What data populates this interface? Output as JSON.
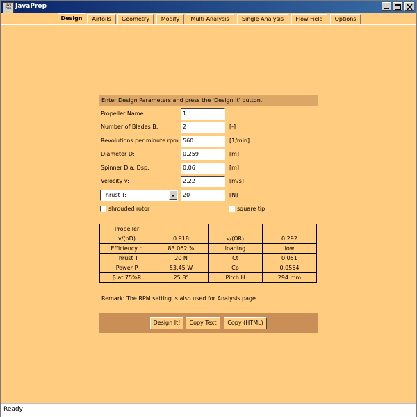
{
  "window": {
    "title": "JavaProp",
    "icon_text": "Java Prop"
  },
  "tabs": [
    {
      "label": "Design",
      "active": true
    },
    {
      "label": "Airfoils"
    },
    {
      "label": "Geometry"
    },
    {
      "label": "Modify"
    },
    {
      "label": "Multi Analysis"
    },
    {
      "label": "Single Analysis"
    },
    {
      "label": "Flow Field"
    },
    {
      "label": "Options"
    }
  ],
  "design": {
    "header": "Enter Design Parameters and press the 'Design It' button.",
    "fields": [
      {
        "label": "Propeller Name:",
        "value": "1",
        "unit": ""
      },
      {
        "label": "Number of Blades  B:",
        "value": "2",
        "unit": "[-]"
      },
      {
        "label": "Revolutions per minute  rpm:",
        "value": "560",
        "unit": "[1/min]"
      },
      {
        "label": "Diameter  D:",
        "value": "0.259",
        "unit": "[m]"
      },
      {
        "label": "Spinner Dia.  Dsp:",
        "value": "0.06",
        "unit": "[m]"
      },
      {
        "label": "Velocity  v:",
        "value": "2.22",
        "unit": "[m/s]"
      }
    ],
    "thrust_select": "Thrust  T:",
    "thrust_value": "20",
    "thrust_unit": "[N]",
    "shrouded_label": "shrouded rotor",
    "square_tip_label": "square tip",
    "results": [
      [
        "Propeller",
        "",
        "",
        ""
      ],
      [
        "v/(nD)",
        "0.918",
        "v/(ΩR)",
        "0.292"
      ],
      [
        "Efficiency η",
        "83.062 %",
        "loading",
        "low"
      ],
      [
        "Thrust  T",
        "20 N",
        "Ct",
        "0.051"
      ],
      [
        "Power  P",
        "53.45 W",
        "Cp",
        "0.0564"
      ],
      [
        "β at 75%R",
        "25.8°",
        "Pitch H",
        "294 mm"
      ]
    ],
    "remark": "Remark: The RPM setting is also used for Analysis page.",
    "buttons": {
      "design": "Design It!",
      "copy_text": "Copy Text",
      "copy_html": "Copy (HTML)"
    }
  },
  "status": "Ready"
}
